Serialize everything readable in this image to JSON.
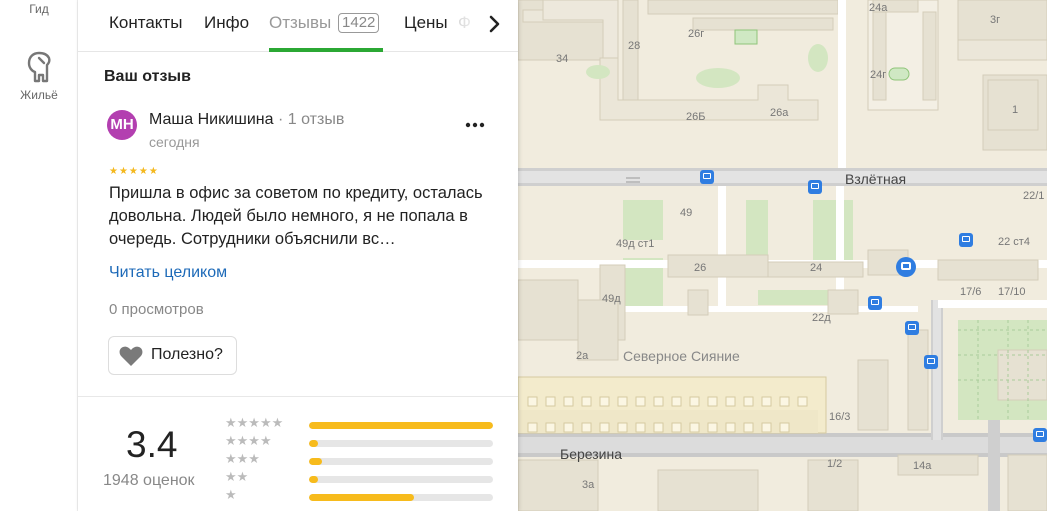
{
  "rail": {
    "guide_label": "Гид",
    "housing_label": "Жильё"
  },
  "tabs": {
    "contacts": "Контакты",
    "info": "Инфо",
    "reviews": "Отзывы",
    "reviews_count": "1422",
    "prices": "Цены",
    "more": "Ф"
  },
  "review": {
    "section_title": "Ваш отзыв",
    "avatar_initials": "МН",
    "author": "Маша Никишина",
    "author_reviews": "1 отзыв",
    "date": "сегодня",
    "stars": "★★★★★",
    "text": "Пришла в офис за советом по кредиту, осталась довольна. Людей было немного, я не попала в очередь. Сотрудники объяснили вс…",
    "read_more": "Читать целиком",
    "views": "0 просмотров",
    "helpful": "Полезно?"
  },
  "rating": {
    "value": "3.4",
    "count": "1948 оценок",
    "distribution": [
      {
        "stars": "★★★★★",
        "fraction": 1.0
      },
      {
        "stars": "★★★★",
        "fraction": 0.05
      },
      {
        "stars": "★★★",
        "fraction": 0.07
      },
      {
        "stars": "★★",
        "fraction": 0.05
      },
      {
        "stars": "★",
        "fraction": 0.57
      }
    ]
  },
  "map": {
    "streets": {
      "vzletnaya": "Взлётная",
      "berezina": "Березина"
    },
    "district": "Северное Сияние",
    "house_numbers": [
      "26г",
      "24а",
      "3г",
      "28",
      "34",
      "24г",
      "26Б",
      "26а",
      "1",
      "22/1",
      "49",
      "49д ст1",
      "22 ст4",
      "26",
      "24",
      "17/6",
      "17/10",
      "49д",
      "22д",
      "2а",
      "16/3",
      "1/2",
      "14а",
      "3а"
    ]
  },
  "colors": {
    "accent_green": "#2ba834",
    "link_blue": "#1d6ab8",
    "star_yellow": "#f4b81e",
    "avatar_purple": "#b33fb0",
    "bus_blue": "#2f7de1"
  }
}
